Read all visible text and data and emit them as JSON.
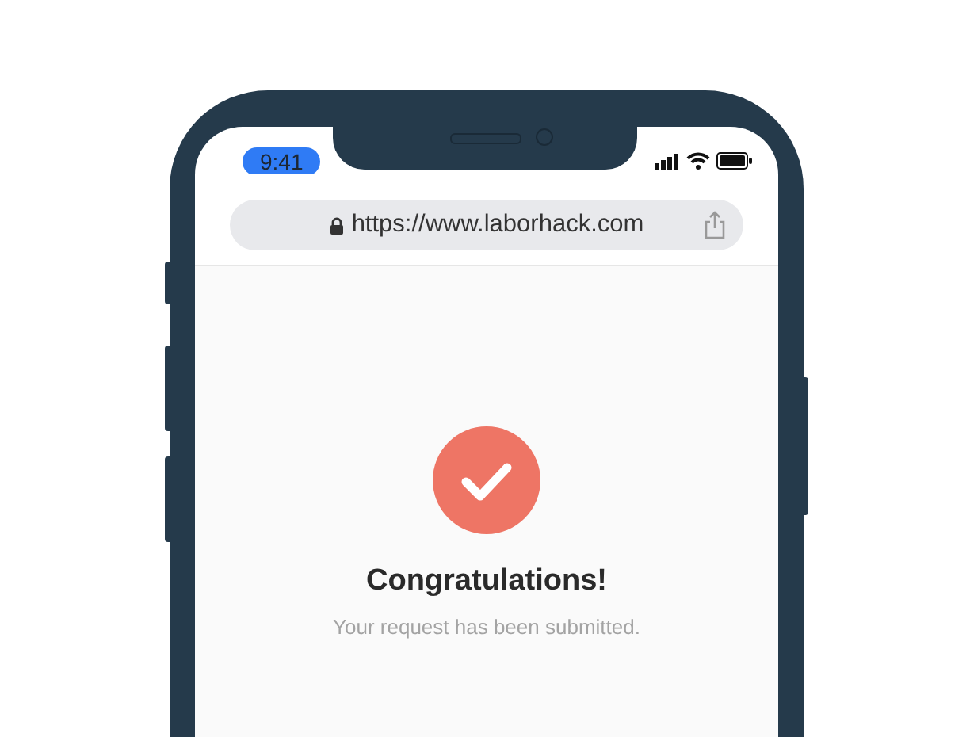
{
  "status_bar": {
    "time": "9:41"
  },
  "address_bar": {
    "url": "https://www.laborhack.com"
  },
  "confirmation": {
    "title": "Congratulations!",
    "message": "Your request has been submitted."
  }
}
